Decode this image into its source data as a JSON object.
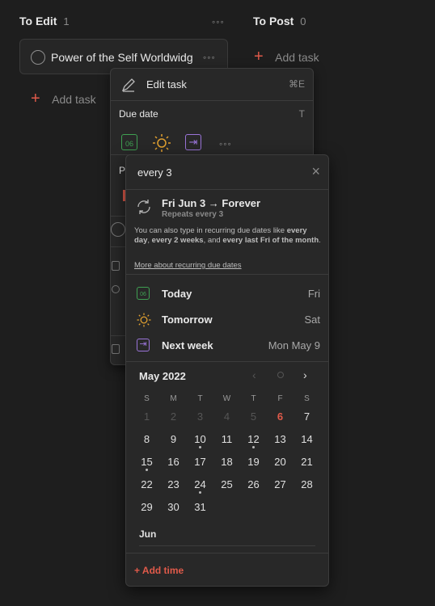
{
  "columns": [
    {
      "title": "To Edit",
      "count": "1"
    },
    {
      "title": "To Post",
      "count": "0"
    }
  ],
  "dots_glyph": "◦◦◦",
  "task": {
    "title": "Power of the Self Worldwidg"
  },
  "add_task_label": "Add task",
  "menu": {
    "edit_task": "Edit task",
    "edit_shortcut": "⌘E",
    "due_date": "Due date",
    "due_shortcut": "T",
    "cal_icon_num": "06",
    "priority_partial": "P"
  },
  "date_picker": {
    "input_value": "every 3",
    "clear": "×",
    "recurring_title": "Fri Jun 3 → Forever",
    "recurring_sub": "Repeats every 3",
    "help_text_1": "You can also type in recurring due dates like",
    "help_b1": "every day",
    "help_b2": "every 2 weeks",
    "help_mid": ", and",
    "help_b3": "every last Fri of the month",
    "help_end": ".",
    "help_link": "More about recurring due dates",
    "quick": [
      {
        "label": "Today",
        "day": "Fri",
        "icon": "calendar-today-icon"
      },
      {
        "label": "Tomorrow",
        "day": "Sat",
        "icon": "sun-icon"
      },
      {
        "label": "Next week",
        "day": "Mon May 9",
        "icon": "next-week-icon"
      }
    ],
    "today_num": "06",
    "month_label": "May 2022",
    "weekdays": [
      "S",
      "M",
      "T",
      "W",
      "T",
      "F",
      "S"
    ],
    "weeks": [
      [
        {
          "d": "1",
          "s": "past"
        },
        {
          "d": "2",
          "s": "past"
        },
        {
          "d": "3",
          "s": "past"
        },
        {
          "d": "4",
          "s": "past"
        },
        {
          "d": "5",
          "s": "past"
        },
        {
          "d": "6",
          "s": "today"
        },
        {
          "d": "7",
          "s": ""
        }
      ],
      [
        {
          "d": "8",
          "s": ""
        },
        {
          "d": "9",
          "s": ""
        },
        {
          "d": "10",
          "s": "",
          "dot": true
        },
        {
          "d": "11",
          "s": ""
        },
        {
          "d": "12",
          "s": "",
          "dot": true
        },
        {
          "d": "13",
          "s": ""
        },
        {
          "d": "14",
          "s": ""
        }
      ],
      [
        {
          "d": "15",
          "s": "",
          "dot": true
        },
        {
          "d": "16",
          "s": ""
        },
        {
          "d": "17",
          "s": ""
        },
        {
          "d": "18",
          "s": ""
        },
        {
          "d": "19",
          "s": ""
        },
        {
          "d": "20",
          "s": ""
        },
        {
          "d": "21",
          "s": ""
        }
      ],
      [
        {
          "d": "22",
          "s": ""
        },
        {
          "d": "23",
          "s": ""
        },
        {
          "d": "24",
          "s": "",
          "dot": true
        },
        {
          "d": "25",
          "s": ""
        },
        {
          "d": "26",
          "s": ""
        },
        {
          "d": "27",
          "s": ""
        },
        {
          "d": "28",
          "s": ""
        }
      ],
      [
        {
          "d": "29",
          "s": ""
        },
        {
          "d": "30",
          "s": ""
        },
        {
          "d": "31",
          "s": ""
        }
      ]
    ],
    "next_month_label": "Jun",
    "add_time": "+ Add time"
  },
  "colors": {
    "accent_red": "#e05a4a",
    "green": "#3fa052",
    "orange": "#e0a030",
    "purple": "#9a74d8"
  }
}
